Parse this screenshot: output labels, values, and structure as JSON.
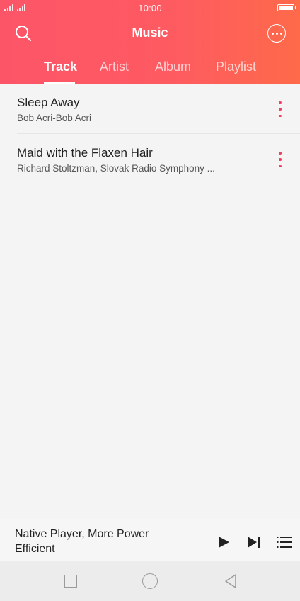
{
  "status_bar": {
    "time": "10:00",
    "icons": [
      "signal-icon",
      "signal-icon",
      "battery-icon"
    ]
  },
  "header": {
    "title": "Music",
    "search_icon": "search-icon",
    "more_icon": "more-options-icon"
  },
  "tabs": [
    {
      "label": "Track",
      "active": true
    },
    {
      "label": "Artist",
      "active": false
    },
    {
      "label": "Album",
      "active": false
    },
    {
      "label": "Playlist",
      "active": false
    }
  ],
  "tracks": [
    {
      "title": "Sleep Away",
      "subtitle": "Bob Acri-Bob Acri"
    },
    {
      "title": "Maid with the Flaxen Hair",
      "subtitle": "Richard Stoltzman, Slovak Radio Symphony ..."
    }
  ],
  "player": {
    "now_playing": "Native Player, More Power Efficient",
    "controls": [
      "play-icon",
      "next-track-icon",
      "queue-list-icon"
    ]
  },
  "nav_bar": {
    "buttons": [
      "recent-apps-icon",
      "home-icon",
      "back-icon"
    ]
  },
  "colors": {
    "header_start": "#fd5568",
    "header_end": "#fe6a4a",
    "accent": "#ee3e62",
    "background": "#f4f4f4"
  }
}
